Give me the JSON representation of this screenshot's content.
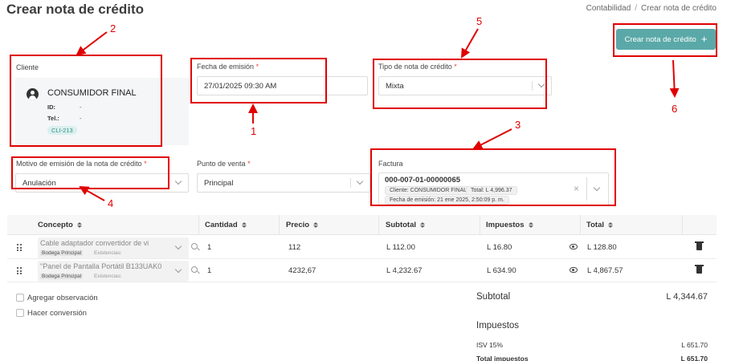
{
  "header": {
    "title": "Crear nota de crédito",
    "breadcrumb": [
      "Contabilidad",
      "/",
      "Crear nota de crédito"
    ]
  },
  "create_button": {
    "label": "Crear nota de crédito",
    "icon": "plus-icon"
  },
  "client": {
    "label": "Cliente",
    "name": "CONSUMIDOR FINAL",
    "id_label": "ID:",
    "id_value": "-",
    "tel_label": "Tel.:",
    "tel_value": "-",
    "code": "CLI-213"
  },
  "issue_date": {
    "label": "Fecha de emisión",
    "required": "*",
    "value": "27/01/2025 09:30 AM"
  },
  "credit_type": {
    "label": "Tipo de nota de crédito",
    "required": "*",
    "value": "Mixta"
  },
  "reason": {
    "label": "Motivo de emisión de la nota de crédito",
    "required": "*",
    "value": "Anulación"
  },
  "point_of_sale": {
    "label": "Punto de venta",
    "required": "*",
    "value": "Principal"
  },
  "invoice": {
    "label": "Factura",
    "number": "000-007-01-00000065",
    "client_chip": "Cliente: CONSUMIDOR FINAL",
    "total_chip": "Total: L 4,996.37",
    "date_chip": "Fecha de emisión: 21 ene 2025, 2:50:09 p. m."
  },
  "table": {
    "headers": [
      "Concepto",
      "Cantidad",
      "Precio",
      "Subtotal",
      "Impuestos",
      "Total"
    ],
    "rows": [
      {
        "concept": "Cable adaptador convertidor de vi",
        "warehouse": "Bodega Principal",
        "stock": "Existencias:",
        "qty": "1",
        "price": "112",
        "subtotal": "L 112.00",
        "tax": "L 16.80",
        "total": "L 128.80"
      },
      {
        "concept": "\"Panel de Pantalla Portátil B133UAK0",
        "warehouse": "Bodega Principal",
        "stock": "Existencias:",
        "qty": "1",
        "price": "4232,67",
        "subtotal": "L 4,232.67",
        "tax": "L 634.90",
        "total": "L 4,867.57"
      }
    ]
  },
  "options": {
    "add_observation": "Agregar observación",
    "conversion": "Hacer conversión"
  },
  "summary": {
    "subtotal_label": "Subtotal",
    "subtotal_value": "L 4,344.67",
    "taxes_label": "Impuestos",
    "isv_label": "ISV 15%",
    "isv_value": "L 651.70",
    "total_taxes_label": "Total impuestos",
    "total_taxes_value": "L 651.70"
  },
  "annotations": [
    "1",
    "2",
    "3",
    "4",
    "5",
    "6"
  ],
  "colors": {
    "accent": "#5aa9a8",
    "annotation": "#e00000",
    "required": "#e64545"
  }
}
